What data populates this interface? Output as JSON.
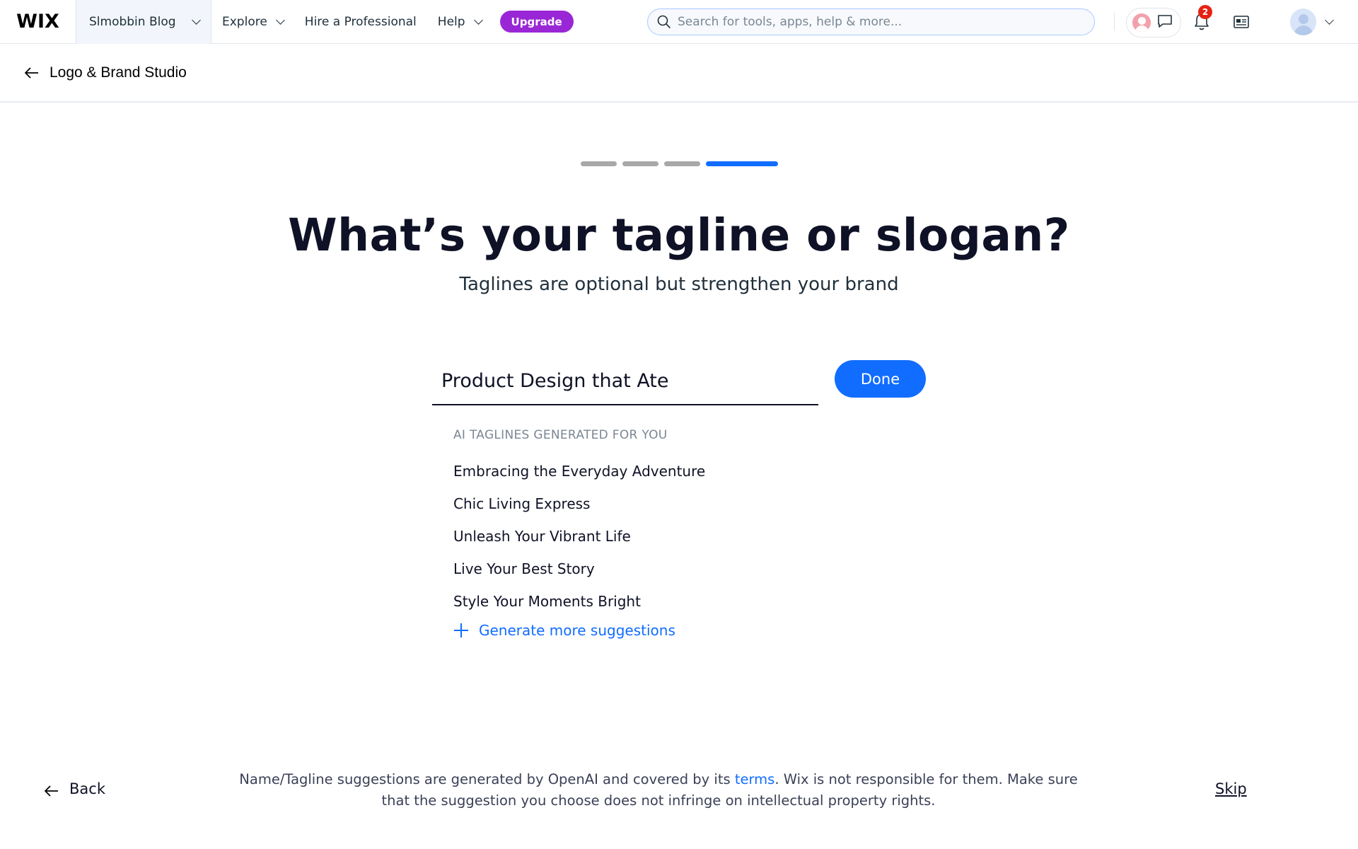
{
  "topbar": {
    "logo": "WIX",
    "site_name": "Slmobbin Blog",
    "nav": [
      {
        "label": "Explore",
        "has_dropdown": true
      },
      {
        "label": "Hire a Professional",
        "has_dropdown": false
      },
      {
        "label": "Help",
        "has_dropdown": true
      }
    ],
    "upgrade_label": "Upgrade",
    "search_placeholder": "Search for tools, apps, help & more...",
    "notification_count": "2",
    "icons": [
      "search-icon",
      "chat-icon",
      "bell-icon",
      "newsfeed-icon",
      "chevron-down-icon"
    ],
    "colors": {
      "upgrade": "#9a27d5",
      "badge": "#e62214"
    }
  },
  "subheader": {
    "back_label": "Logo & Brand Studio"
  },
  "progress": {
    "total_steps": 4,
    "current_step": 4
  },
  "main": {
    "title": "What’s your tagline or slogan?",
    "subtitle": "Taglines are optional but strengthen your brand",
    "input_value": "Product Design that Ate",
    "done_label": "Done",
    "suggestions_heading": "AI TAGLINES GENERATED FOR YOU",
    "suggestions": [
      "Embracing the Everyday Adventure",
      "Chic Living Express",
      "Unleash Your Vibrant Life",
      "Live Your Best Story",
      "Style Your Moments Bright"
    ],
    "generate_label": "Generate more suggestions"
  },
  "footer": {
    "back_label": "Back",
    "disclaimer_before": "Name/Tagline suggestions are generated by OpenAI and covered by its ",
    "disclaimer_link": "terms",
    "disclaimer_after": ". Wix is not responsible for them. Make sure that the suggestion you choose does not infringe on intellectual property rights.",
    "skip_label": "Skip"
  },
  "colors": {
    "accent": "#116dff",
    "heading": "#0f1226"
  }
}
